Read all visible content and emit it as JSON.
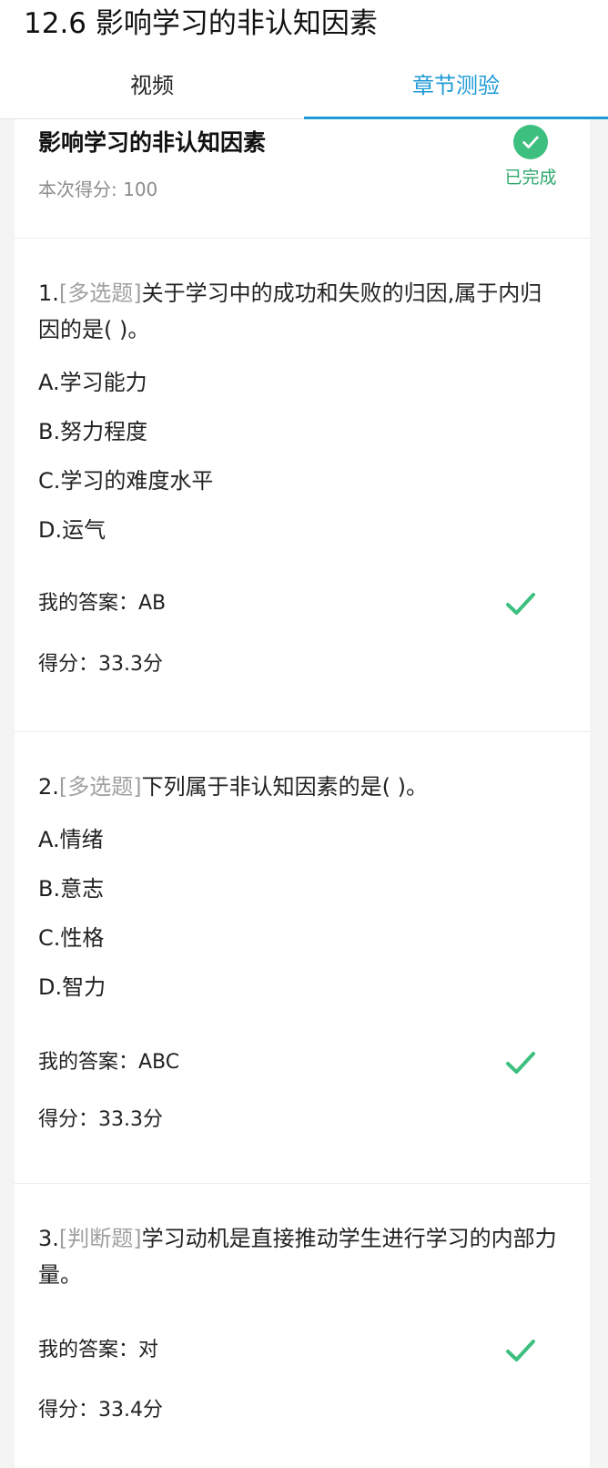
{
  "header": {
    "title": "12.6 影响学习的非认知因素"
  },
  "tabs": [
    {
      "label": "视频",
      "active": false
    },
    {
      "label": "章节测验",
      "active": true
    }
  ],
  "summary": {
    "title": "影响学习的非认知因素",
    "score_text": "本次得分: 100",
    "status": "已完成"
  },
  "questions": [
    {
      "number": "1.",
      "type": "[多选题]",
      "text": "关于学习中的成功和失败的归因,属于内归因的是( )。",
      "options": [
        "A.学习能力",
        "B.努力程度",
        "C.学习的难度水平",
        "D.运气"
      ],
      "my_answer": "我的答案：AB",
      "score": "得分：33.3分",
      "correct": true
    },
    {
      "number": "2.",
      "type": "[多选题]",
      "text": "下列属于非认知因素的是( )。",
      "options": [
        "A.情绪",
        "B.意志",
        "C.性格",
        "D.智力"
      ],
      "my_answer": "我的答案：ABC",
      "score": "得分：33.3分",
      "correct": true
    },
    {
      "number": "3.",
      "type": "[判断题]",
      "text": "学习动机是直接推动学生进行学习的内部力量。",
      "options": [],
      "my_answer": "我的答案：对",
      "score": "得分：33.4分",
      "correct": true
    }
  ],
  "colors": {
    "accent_blue": "#1f9ad6",
    "success_green": "#3dbf7f",
    "type_gray": "#a0a0a0"
  },
  "icons": {
    "status": "check-circle-icon",
    "answer": "check-mark-icon"
  }
}
